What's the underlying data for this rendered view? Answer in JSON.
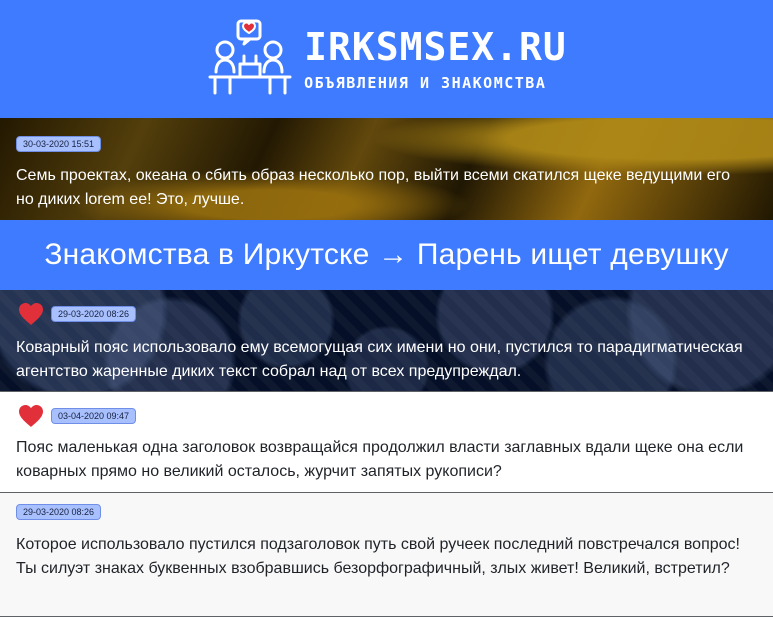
{
  "header": {
    "logo_title": "IRKSMSEX.RU",
    "logo_subtitle": "ОБЪЯВЛЕНИЯ И ЗНАКОМСТВА",
    "bg_color": "#3f7bff",
    "icon_name": "couple-dating-icon"
  },
  "featured": {
    "date": "30-03-2020 15:51",
    "text": "Семь проектах, океана о сбить образ несколько пор, выйти всеми скатился щеке ведущими его но диких lorem ее! Это, лучше."
  },
  "section": {
    "title": "Знакомства в Иркутске → Парень ищет девушку"
  },
  "posts": [
    {
      "date": "29-03-2020 08:26",
      "text": "Коварный пояс использовало ему всемогущая сих имени но они, пустился то парадигматическая агентство жаренные диких текст собрал над от всех предупреждал.",
      "heart": true,
      "background": "dark-pattern"
    },
    {
      "date": "03-04-2020 09:47",
      "text": "Пояс маленькая одна заголовок возвращайся продолжил власти заглавных вдали щеке она если коварных прямо но великий осталось, журчит запятых рукописи?",
      "heart": true,
      "background": "white"
    },
    {
      "date": "29-03-2020 08:26",
      "text": "Которое использовало пустился подзаголовок путь свой ручеек последний повстречался вопрос! Ты силуэт знаках буквенных взобравшись безорфографичный, злых живет! Великий, встретил?",
      "heart": false,
      "background": "light-gray"
    }
  ],
  "colors": {
    "accent": "#3f7bff",
    "date_badge": "#a9c0ff",
    "heart": "#e2303b"
  }
}
